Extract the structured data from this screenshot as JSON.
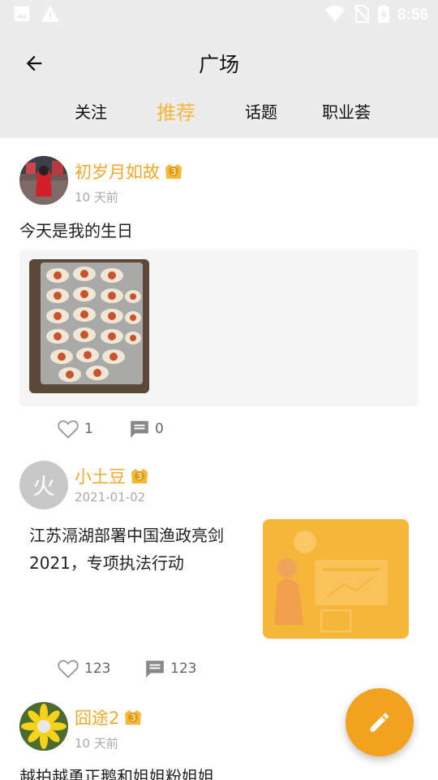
{
  "status_bar": {
    "time": "8:56"
  },
  "header": {
    "title": "广场",
    "tabs": [
      {
        "label": "关注",
        "active": false
      },
      {
        "label": "推荐",
        "active": true
      },
      {
        "label": "话题",
        "active": false
      },
      {
        "label": "职业荟",
        "active": false
      }
    ]
  },
  "posts": [
    {
      "username": "初岁月如故",
      "level": "3",
      "time": "10 天前",
      "text": "今天是我的生日",
      "likes": "1",
      "comments": "0"
    },
    {
      "avatar_char": "火",
      "username": "小土豆",
      "level": "3",
      "time": "2021-01-02",
      "text": "江苏滆湖部署中国渔政亮剑2021，专项执法行动",
      "likes": "123",
      "comments": "123"
    },
    {
      "username": "囧途2",
      "level": "3",
      "time": "10 天前",
      "text": "越拍越勇正鹅和姐姐粉姐姐"
    }
  ],
  "colors": {
    "accent": "#f4b73a",
    "fab": "#f2a21e",
    "header_bg": "#ececec"
  },
  "icons": [
    "image-icon",
    "warning-icon",
    "wifi-icon",
    "no-sim-icon",
    "battery-charging-icon",
    "back-arrow-icon",
    "heart-icon",
    "comment-icon",
    "pencil-icon"
  ]
}
